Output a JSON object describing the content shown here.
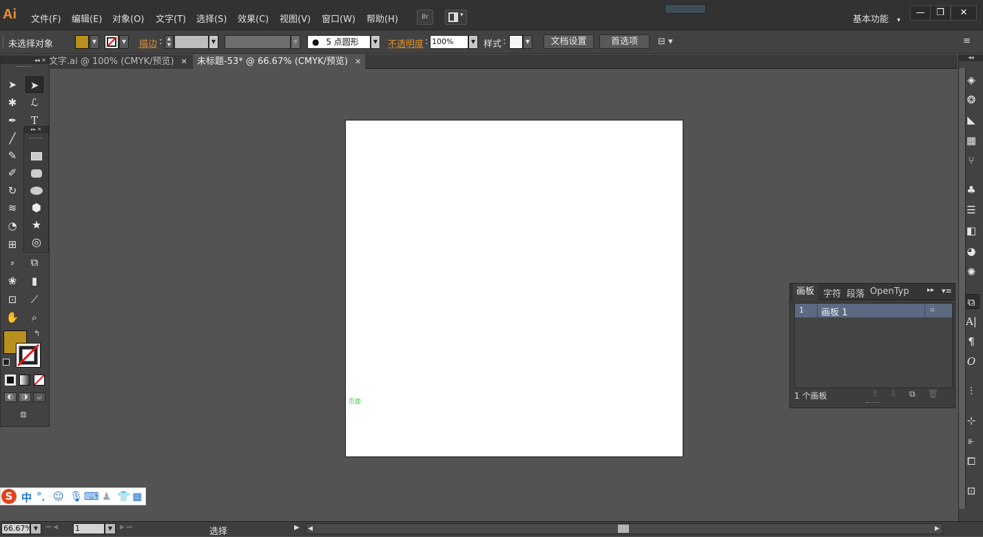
{
  "app": {
    "logo": "Ai"
  },
  "menubar": {
    "items": [
      "文件(F)",
      "编辑(E)",
      "对象(O)",
      "文字(T)",
      "选择(S)",
      "效果(C)",
      "视图(V)",
      "窗口(W)",
      "帮助(H)"
    ],
    "bridge_label": "Br",
    "workspace_label": "基本功能",
    "workspace_arrow": "▾",
    "window_controls": {
      "minimize": "—",
      "restore": "❐",
      "close": "✕"
    }
  },
  "control_bar": {
    "selection_status": "未选择对象",
    "stroke_label": "描边",
    "brush_label": "5 点圆形",
    "opacity_label": "不透明度",
    "opacity_value": "100%",
    "style_label": "样式",
    "document_setup_button": "文档设置",
    "preferences_button": "首选项",
    "fill_color": "#b8901e"
  },
  "tabs": [
    {
      "label": "文字.ai @ 100% (CMYK/预览)",
      "active": false
    },
    {
      "label": "未标题-53* @ 66.67% (CMYK/预览)",
      "active": true
    }
  ],
  "canvas": {
    "cursor_hint": "页面"
  },
  "artboards_panel": {
    "tabs": [
      "画板",
      "字符",
      "段落",
      "OpenTyp"
    ],
    "rows": [
      {
        "index": "1",
        "name": "画板 1"
      }
    ],
    "count_text": "1 个画板"
  },
  "statusbar": {
    "zoom": "66.67%",
    "artboard_nav": "1",
    "tool_name": "选择"
  },
  "ime": {
    "mode": "中",
    "punct": "°,"
  }
}
